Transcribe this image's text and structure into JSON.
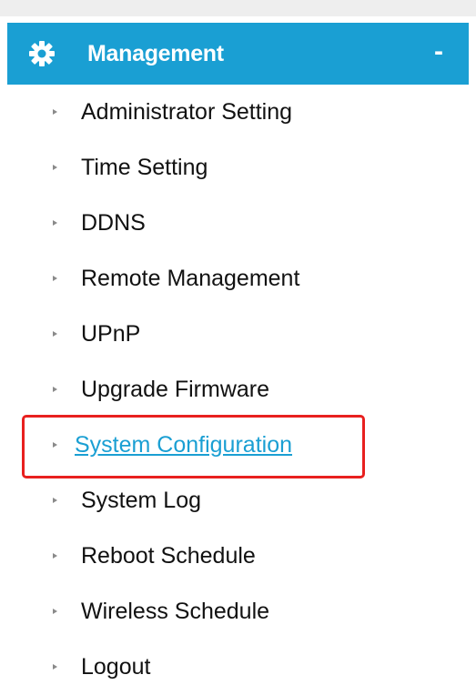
{
  "header": {
    "title": "Management",
    "collapse_symbol": "-",
    "icon": "gear-icon",
    "color": "#1a9fd3"
  },
  "menu": {
    "items": [
      {
        "label": "Administrator Setting"
      },
      {
        "label": "Time Setting"
      },
      {
        "label": "DDNS"
      },
      {
        "label": "Remote Management"
      },
      {
        "label": "UPnP"
      },
      {
        "label": "Upgrade Firmware"
      },
      {
        "label": "System Configuration",
        "active": true
      },
      {
        "label": "System Log"
      },
      {
        "label": "Reboot Schedule"
      },
      {
        "label": "Wireless Schedule"
      },
      {
        "label": "Logout"
      }
    ]
  },
  "highlight": {
    "color": "#e8201f",
    "target": "System Configuration"
  }
}
